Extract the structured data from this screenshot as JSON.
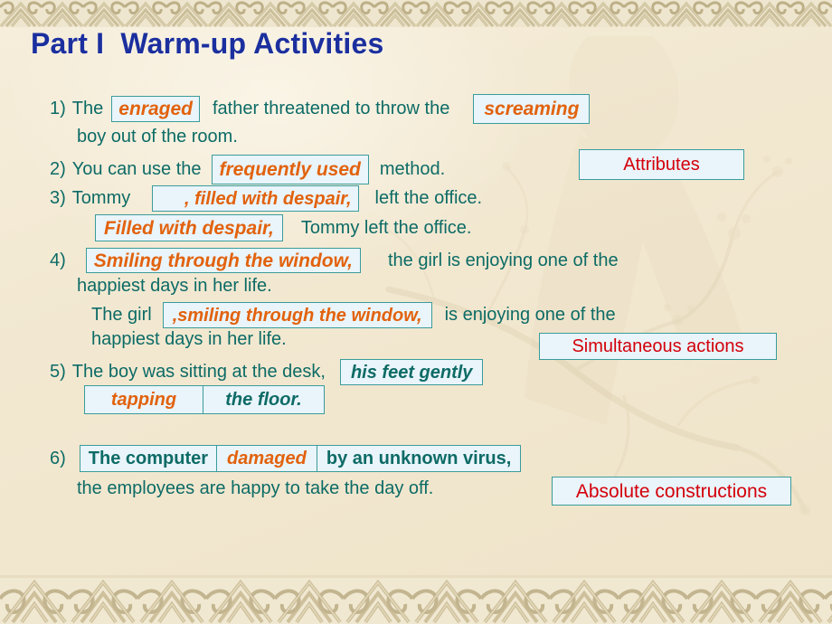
{
  "slide": {
    "title": "Part I  Warm-up Activities",
    "background_color": "#f2e8d1",
    "text_color": "#0d6b66",
    "title_color": "#1b2f9e",
    "highlight_orange": "#e2620d",
    "label_red": "#d4000a",
    "box_fill": "#e9f4fb",
    "box_border": "#3a9c9b",
    "border_pattern": "celtic-knot-band"
  },
  "items": [
    {
      "number": "1)",
      "segments": [
        {
          "text": "The",
          "style": "plain"
        },
        {
          "text": "enraged",
          "style": "box-orange"
        },
        {
          "text": "father threatened to throw the",
          "style": "plain"
        },
        {
          "text": "screaming",
          "style": "box-orange"
        }
      ],
      "continuation": "boy out of the room."
    },
    {
      "number": "2)",
      "segments": [
        {
          "text": "You can use the",
          "style": "plain"
        },
        {
          "text": "frequently used",
          "style": "box-orange"
        },
        {
          "text": "method.",
          "style": "plain"
        }
      ],
      "label": "Attributes"
    },
    {
      "number": "3)",
      "segments": [
        {
          "text": "Tommy",
          "style": "plain"
        },
        {
          "text": "     , filled with despair,",
          "style": "box-orange"
        },
        {
          "text": "left the office.",
          "style": "plain"
        }
      ],
      "alternate": {
        "segments": [
          {
            "text": "Filled with despair,",
            "style": "box-orange"
          },
          {
            "text": "Tommy left the office.",
            "style": "plain"
          }
        ]
      }
    },
    {
      "number": "4)",
      "segments": [
        {
          "text": "Smiling through the window,",
          "style": "box-orange"
        },
        {
          "text": "the girl is enjoying one of the",
          "style": "plain"
        }
      ],
      "continuation": "happiest days in her life.",
      "alternate": {
        "segments": [
          {
            "text": "The girl",
            "style": "plain"
          },
          {
            "text": ",smiling through the window,",
            "style": "box-orange"
          },
          {
            "text": "is enjoying one of the",
            "style": "plain"
          }
        ],
        "continuation": "happiest days in her life."
      }
    },
    {
      "number": "5)",
      "segments": [
        {
          "text": "The boy was sitting at the desk,",
          "style": "plain"
        },
        {
          "text": "his feet gently",
          "style": "box-teal"
        },
        {
          "text": "tapping",
          "style": "box-orange"
        },
        {
          "text": "the floor.",
          "style": "box-teal"
        }
      ],
      "label": "Simultaneous actions"
    },
    {
      "number": "6)",
      "segments": [
        {
          "text": "The computer",
          "style": "box-teal-upright"
        },
        {
          "text": "damaged",
          "style": "box-orange"
        },
        {
          "text": "by an unknown virus,",
          "style": "box-teal-upright"
        },
        {
          "text": "the employees are happy to take the day off.",
          "style": "plain"
        }
      ],
      "label": "Absolute constructions"
    }
  ],
  "text": {
    "l1_the": "The",
    "l1_enraged": "enraged",
    "l1_father": "father threatened to throw the",
    "l1_screaming": "screaming",
    "l1_cont": "boy out of the room.",
    "n1": "1)",
    "l2_you": "You can use the",
    "l2_freq": "frequently used",
    "l2_method": "method.",
    "l2_attributes": "Attributes",
    "n2": "2)",
    "l3_tommy": "Tommy",
    "l3_filled": "     , filled with despair,",
    "l3_left": "left the office.",
    "l3b_filled": "Filled with despair,",
    "l3b_rest": "Tommy left the office.",
    "n3": "3)",
    "l4_smiling": "Smiling through the window,",
    "l4_rest": "the girl is enjoying one of the",
    "l4_cont": "happiest days in her life.",
    "l4b_girl": "The girl",
    "l4b_smiling": ",smiling through the window,",
    "l4b_rest": "is enjoying one of the",
    "l4b_cont": "happiest days in her life.",
    "n4": "4)",
    "l5_boy": "The boy was sitting at the desk,",
    "l5_feet": "his feet gently",
    "l5_tapping": "tapping",
    "l5_floor": "the floor.",
    "l5_simul": "Simultaneous actions",
    "n5": "5)",
    "l6_computer": "The computer",
    "l6_damaged": "damaged",
    "l6_virus": "by an unknown virus,",
    "l6_virus_text": "by an unknown virus",
    "l6_virus_comma": ",",
    "l6_cont": "the employees are happy to take the day off.",
    "l6_absolute": "Absolute constructions",
    "n6": "6)"
  }
}
